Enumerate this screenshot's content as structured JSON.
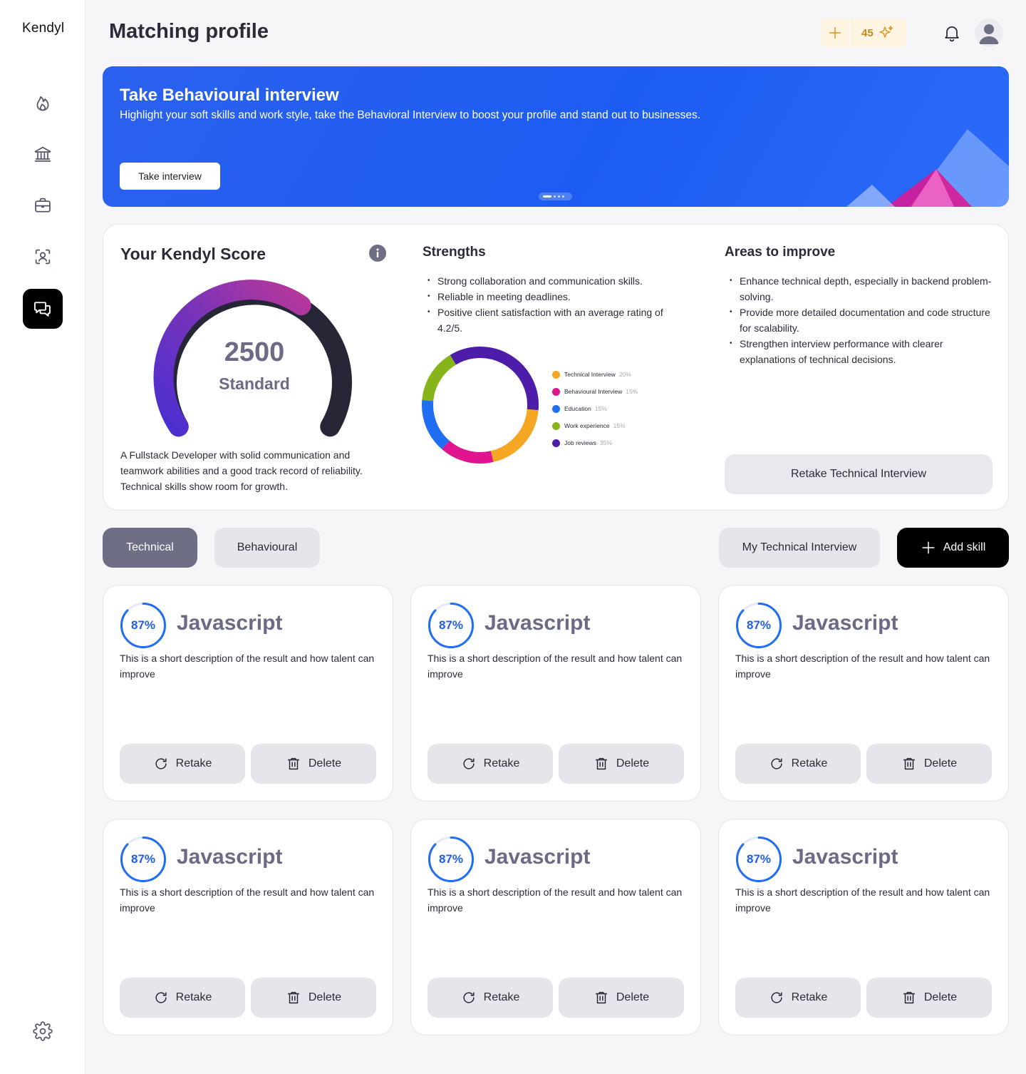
{
  "app": {
    "logo": "Kendyl"
  },
  "header": {
    "title": "Matching profile",
    "credits": "45"
  },
  "sidebar": {
    "items": [
      {
        "name": "flame-icon",
        "active": false
      },
      {
        "name": "bank-icon",
        "active": false
      },
      {
        "name": "briefcase-icon",
        "active": false
      },
      {
        "name": "profile-scan-icon",
        "active": false
      },
      {
        "name": "chat-icon",
        "active": true
      }
    ],
    "settings": "gear-icon"
  },
  "banner": {
    "title": "Take Behavioural interview",
    "subtitle": "Highlight your soft skills and work style, take the Behavioral Interview to boost your profile and stand out to businesses.",
    "button": "Take interview"
  },
  "score": {
    "title": "Your Kendyl Score",
    "value": "2500",
    "level": "Standard",
    "description": "A Fullstack Developer with solid communication and teamwork abilities and a good track record of reliability. Technical skills show room for growth."
  },
  "strengths": {
    "title": "Strengths",
    "items": [
      "Strong collaboration and communication skills.",
      "Reliable in meeting deadlines.",
      "Positive client satisfaction with an average rating of 4.2/5."
    ]
  },
  "improve": {
    "title": "Areas to improve",
    "items": [
      "Enhance technical depth, especially in backend problem-solving.",
      "Provide more detailed documentation and code structure for scalability.",
      "Strengthen interview performance with clearer explanations of technical decisions."
    ],
    "button": "Retake Technical Interview"
  },
  "breakdown": {
    "items": [
      {
        "label": "Technical Interview",
        "pct": "20%",
        "value": 20,
        "color": "#f5a623"
      },
      {
        "label": "Behavioural Interview",
        "pct": "15%",
        "value": 15,
        "color": "#e0148f"
      },
      {
        "label": "Education",
        "pct": "15%",
        "value": 15,
        "color": "#1f6ef3"
      },
      {
        "label": "Work experience",
        "pct": "15%",
        "value": 15,
        "color": "#86b51b"
      },
      {
        "label": "Job reviews",
        "pct": "35%",
        "value": 35,
        "color": "#4d1ca8"
      }
    ]
  },
  "tabs": {
    "technical": "Technical",
    "behavioural": "Behavioural"
  },
  "actions": {
    "my_interview": "My Technical Interview",
    "add_skill": "Add skill"
  },
  "skills": [
    {
      "percent": "87%",
      "value": 0.87,
      "name": "Javascript",
      "description": "This is a short description of the result and how talent can improve",
      "retake": "Retake",
      "delete": "Delete"
    },
    {
      "percent": "87%",
      "value": 0.87,
      "name": "Javascript",
      "description": "This is a short description of the result and how talent can improve",
      "retake": "Retake",
      "delete": "Delete"
    },
    {
      "percent": "87%",
      "value": 0.87,
      "name": "Javascript",
      "description": "This is a short description of the result and how talent can improve",
      "retake": "Retake",
      "delete": "Delete"
    },
    {
      "percent": "87%",
      "value": 0.87,
      "name": "Javascript",
      "description": "This is a short description of the result and how talent can improve",
      "retake": "Retake",
      "delete": "Delete"
    },
    {
      "percent": "87%",
      "value": 0.87,
      "name": "Javascript",
      "description": "This is a short description of the result and how talent can improve",
      "retake": "Retake",
      "delete": "Delete"
    },
    {
      "percent": "87%",
      "value": 0.87,
      "name": "Javascript",
      "description": "This is a short description of the result and how talent can improve",
      "retake": "Retake",
      "delete": "Delete"
    }
  ]
}
